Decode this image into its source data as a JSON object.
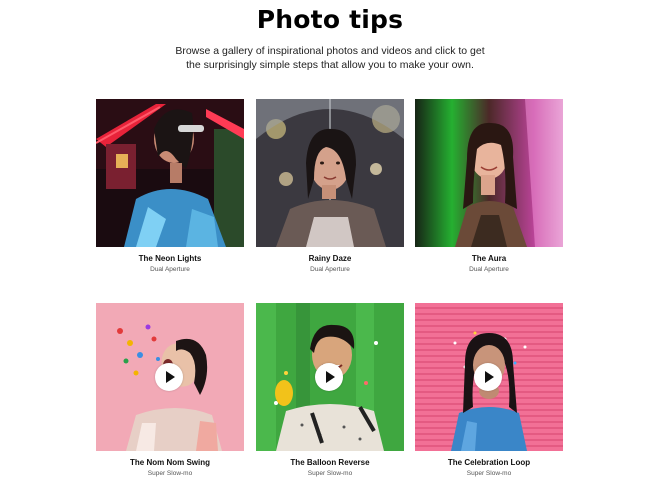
{
  "header": {
    "title": "Photo tips",
    "subtitle": "Browse a gallery of inspirational photos and videos and click to get the surprisingly simple steps that allow you to make your own."
  },
  "cards": [
    {
      "title": "The Neon Lights",
      "subtitle": "Dual Aperture",
      "video": false
    },
    {
      "title": "Rainy Daze",
      "subtitle": "Dual Aperture",
      "video": false
    },
    {
      "title": "The Aura",
      "subtitle": "Dual Aperture",
      "video": false
    },
    {
      "title": "The Nom Nom Swing",
      "subtitle": "Super Slow-mo",
      "video": true
    },
    {
      "title": "The Balloon Reverse",
      "subtitle": "Super Slow-mo",
      "video": true
    },
    {
      "title": "The Celebration Loop",
      "subtitle": "Super Slow-mo",
      "video": true
    }
  ],
  "colors": {
    "neon": "#c8172a",
    "rain": "#6b6a70",
    "aura": "#2fbf3a",
    "pink": "#f0a6b4",
    "green": "#3aa33c",
    "stripes": "#f06c92"
  }
}
